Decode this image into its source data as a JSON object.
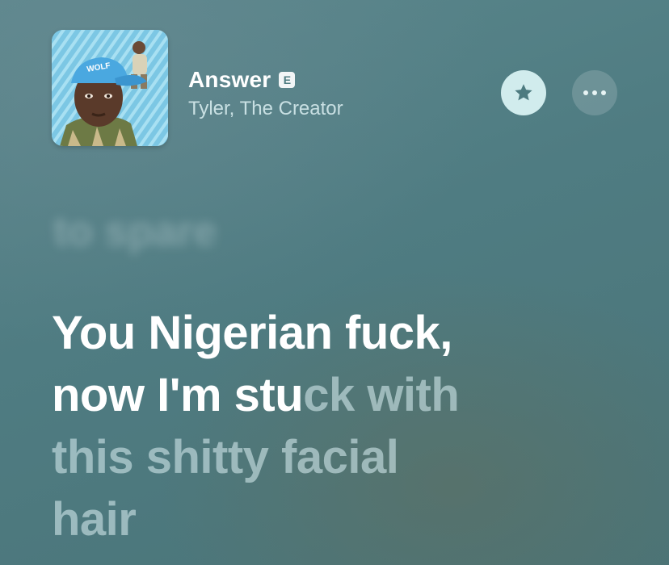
{
  "track": {
    "title": "Answer",
    "explicit_badge": "E",
    "artist": "Tyler, The Creator",
    "album_art": {
      "description": "album-art",
      "cap_text": "WOLF"
    }
  },
  "actions": {
    "favorite_icon": "star-icon",
    "more_icon": "ellipsis-icon"
  },
  "lyrics": {
    "previous_line": "to spare",
    "current": {
      "line1_sung": "You Nigerian fuck,",
      "line2_sung": "now I'm stu",
      "line2_unsung": "ck with",
      "line3_unsung": "this shitty facial",
      "line4_unsung": "hair"
    }
  },
  "colors": {
    "accent_button": "#dcf5f6",
    "sung_text": "#ffffff",
    "unsung_text": "#cde4e6"
  }
}
